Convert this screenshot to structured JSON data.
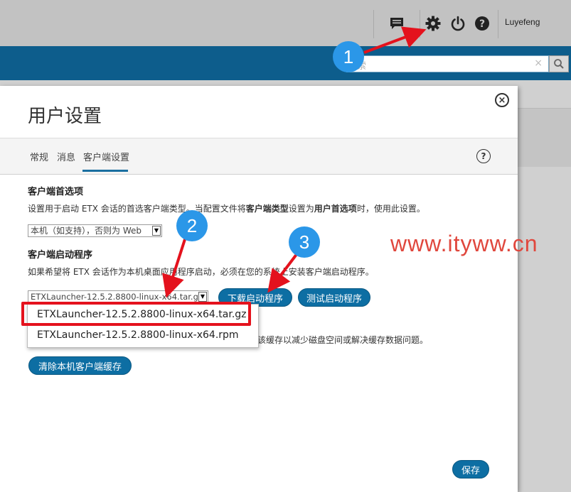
{
  "topbar": {
    "username": "Luyefeng"
  },
  "search": {
    "placeholder": "搜索",
    "visible_text": "索",
    "clear_icon": "×"
  },
  "dialog": {
    "title": "用户设置",
    "close_icon": "×",
    "help_icon": "?",
    "tabs": [
      {
        "label": "常规"
      },
      {
        "label": "消息"
      },
      {
        "label": "客户端设置",
        "active": true
      }
    ],
    "preferred": {
      "title": "客户端首选项",
      "desc_1": "设置用于启动 ETX 会话的首选客户端类型。当配置文件将",
      "desc_b1": "客户端类型",
      "desc_2": "设置为",
      "desc_b2": "用户首选项",
      "desc_3": "时，使用此设置。",
      "select_value": "本机（如支持），否则为 Web"
    },
    "launcher": {
      "title": "客户端启动程序",
      "desc": "如果希望将 ETX 会话作为本机桌面应用程序启动，必须在您的系统上安装客户端启动程序。",
      "select_value": "ETXLauncher-12.5.2.8800-linux-x64.tar.gz",
      "options": [
        "ETXLauncher-12.5.2.8800-linux-x64.tar.gz",
        "ETXLauncher-12.5.2.8800-linux-x64.rpm"
      ],
      "download_button": "下载启动程序",
      "test_button": "测试启动程序"
    },
    "cache": {
      "desc_visible": "该缓存以减少磁盘空间或解决缓存数据问题。",
      "clear_button": "清除本机客户端缓存"
    },
    "save_button": "保存"
  },
  "annotations": {
    "badges": [
      "1",
      "2",
      "3"
    ],
    "watermark": "www.ityww.cn",
    "badge_color": "#2b97e8",
    "arrow_color": "#e4121d"
  },
  "colors": {
    "navbar": "#0d5d8c",
    "accent": "#0d6ea3"
  }
}
